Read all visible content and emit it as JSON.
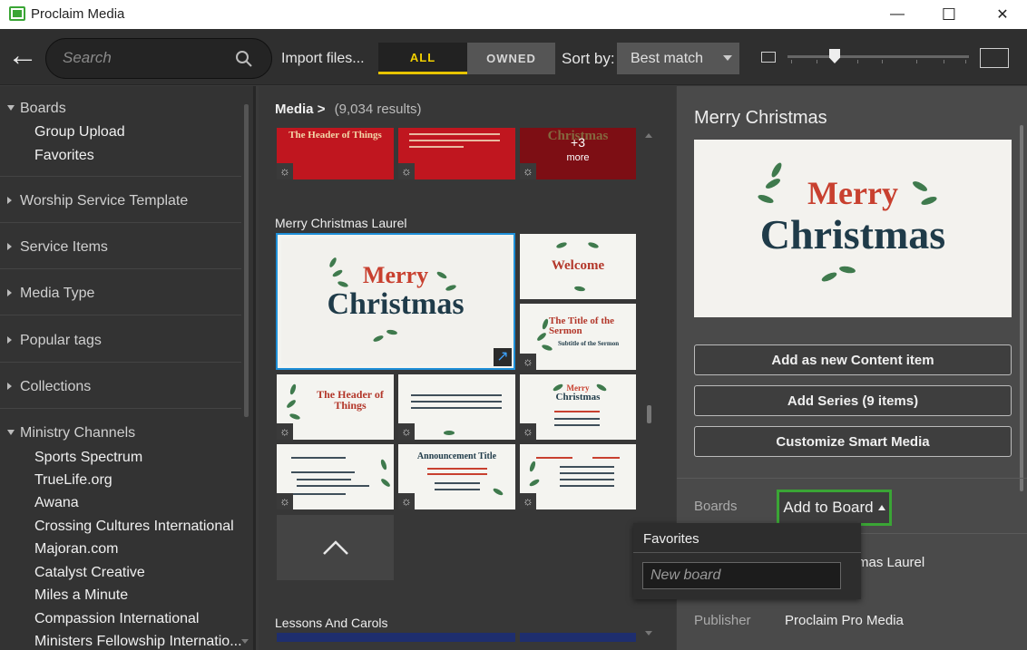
{
  "window": {
    "title": "Proclaim Media",
    "minimize": "—",
    "maximize": "☐",
    "close": "✕"
  },
  "toolbar": {
    "back": "←",
    "search_placeholder": "Search",
    "import_label": "Import files...",
    "filter_all": "ALL",
    "filter_owned": "OWNED",
    "sort_label": "Sort by:",
    "sort_value": "Best match",
    "accent_color": "#e8c400"
  },
  "sidebar": {
    "boards_header": "Boards",
    "boards_items": [
      "Group Upload",
      "Favorites"
    ],
    "sections": [
      "Worship Service Template",
      "Service Items",
      "Media Type",
      "Popular tags",
      "Collections"
    ],
    "channels_header": "Ministry Channels",
    "channels": [
      "Sports Spectrum",
      "TrueLife.org",
      "Awana",
      "Crossing Cultures International",
      "Majoran.com",
      "Catalyst Creative",
      "Miles a Minute",
      "Compassion International",
      "Ministers Fellowship Internatio..."
    ]
  },
  "media": {
    "breadcrumb": "Media",
    "breadcrumb_sep": ">",
    "results": "(9,034 results)",
    "top_row": {
      "thumb1_title": "The Header of Things",
      "more_count": "+3",
      "more_label": "more",
      "more_bg_text": "Christmas"
    },
    "group_title": "Merry Christmas Laurel",
    "selected": {
      "line1": "Merry",
      "line2": "Christmas"
    },
    "thumbs": {
      "welcome": "Welcome",
      "sermon_title": "The Title of the Sermon",
      "sermon_subtitle": "Subtitle of the Sermon",
      "header": "The Header of Things",
      "mini_merry": "Merry",
      "mini_christmas": "Christmas",
      "announcement": "Announcement Title"
    },
    "up_button": "⌃",
    "group2_title": "Lessons And Carols"
  },
  "detail": {
    "title": "Merry Christmas",
    "preview_line1": "Merry",
    "preview_line2": "Christmas",
    "btn_add_content": "Add as new Content item",
    "btn_add_series": "Add Series (9 items)",
    "btn_customize": "Customize Smart Media",
    "boards_label": "Boards",
    "add_to_board": "Add to Board",
    "group_value": "mas Laurel",
    "publisher_label": "Publisher",
    "publisher_value": "Proclaim Pro Media",
    "highlight_color": "#3aa535"
  },
  "dropdown": {
    "item": "Favorites",
    "new_board_placeholder": "New board"
  }
}
